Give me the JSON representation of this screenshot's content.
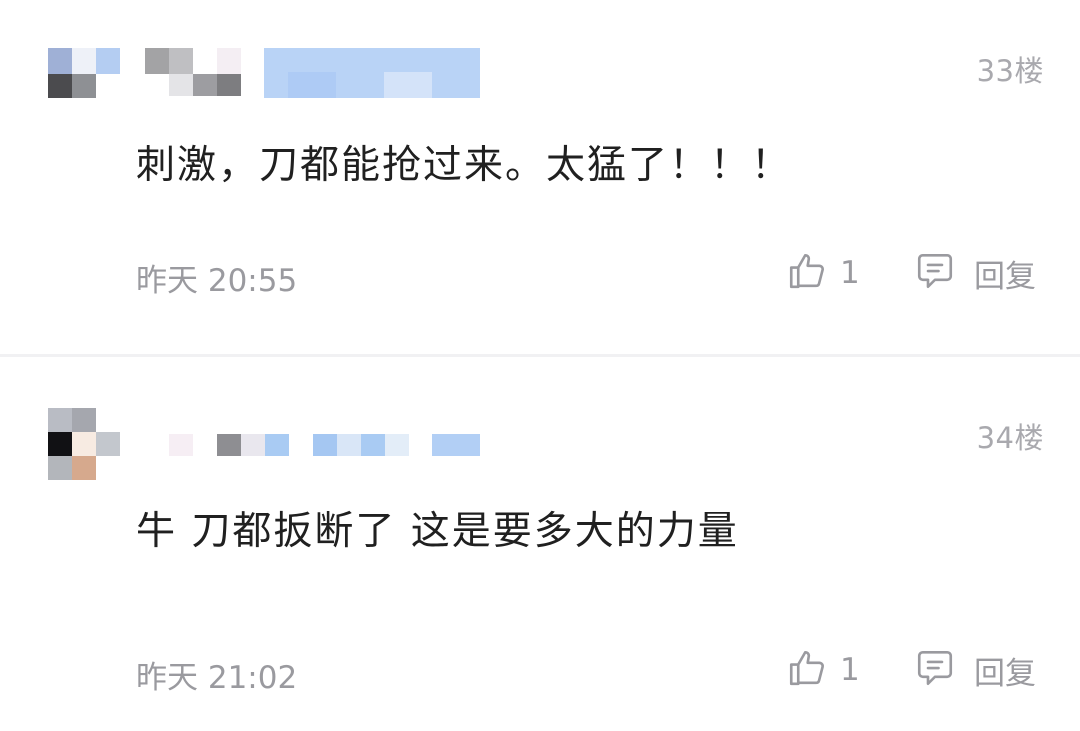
{
  "comments": [
    {
      "floor": "33楼",
      "content": "刺激，刀都能抢过来。太猛了！！！",
      "time": "昨天 20:55",
      "likes": "1",
      "reply_label": "回复"
    },
    {
      "floor": "34楼",
      "content": "牛  刀都扳断了 这是要多大的力量",
      "time": "昨天 21:02",
      "likes": "1",
      "reply_label": "回复"
    }
  ],
  "icons": {
    "like": "thumbs-up-icon",
    "reply": "comment-bubble-icon"
  },
  "colors": {
    "secondary_text": "#9a9a9f",
    "main_text": "#202020",
    "divider": "#f1f1f3"
  }
}
